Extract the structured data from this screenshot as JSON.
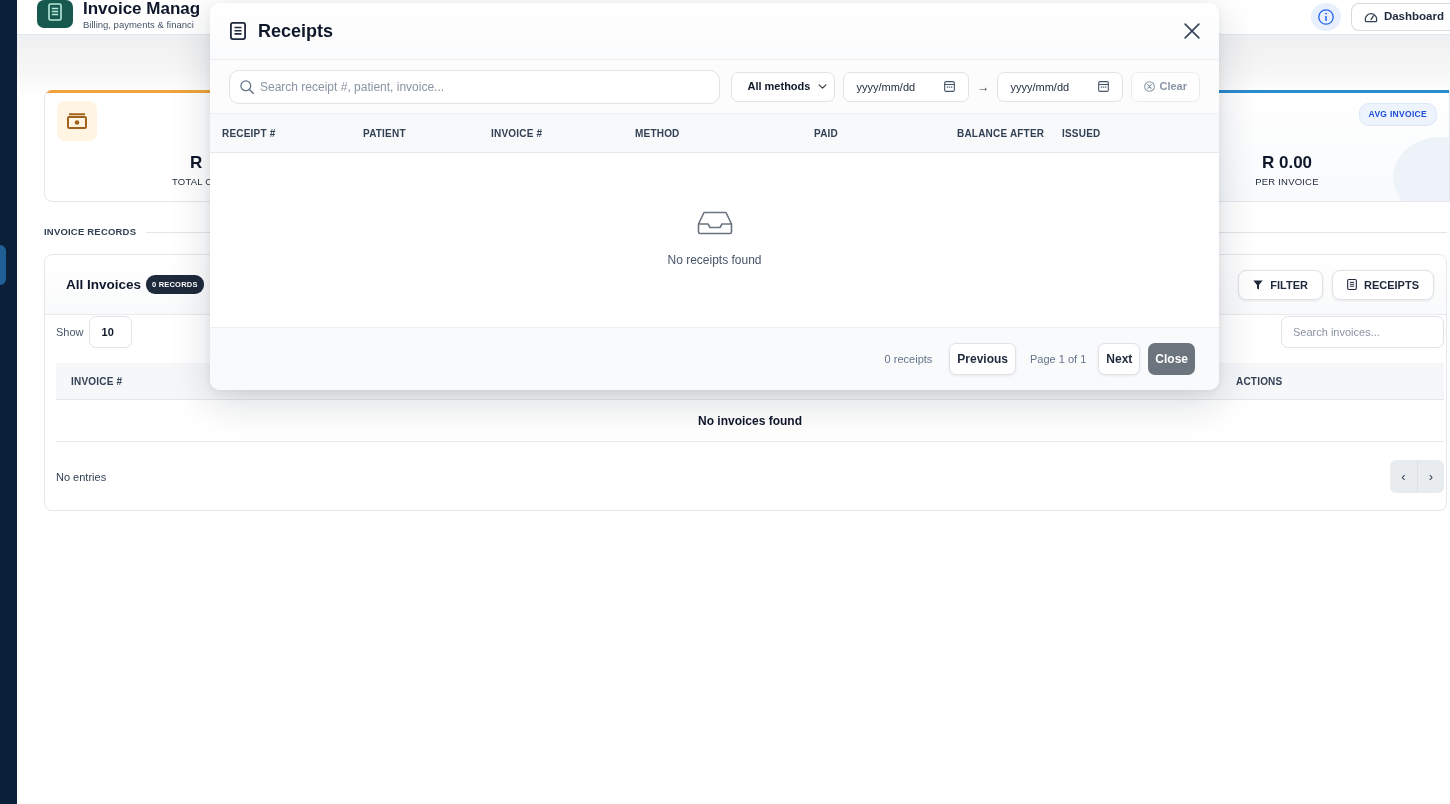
{
  "sidebar": {
    "items": [
      {
        "selected": true
      }
    ]
  },
  "header": {
    "title": "Invoice Manag",
    "subtitle": "Billing, payments & financi",
    "dashboard_button": {
      "label": "Dashboard"
    }
  },
  "stats": [
    {
      "kind": "icon",
      "value": "R",
      "label": "TOTAL C",
      "color": "#f0a33a"
    },
    {
      "kind": "badge",
      "badge": "AVG INVOICE",
      "value": "R 0.00",
      "label": "PER INVOICE",
      "color": "#2a8ccf"
    }
  ],
  "section_label": "INVOICE RECORDS",
  "invoices": {
    "title": "All Invoices",
    "count_badge": "0 RECORDS",
    "buttons": [
      {
        "kind": "filter",
        "label": "FILTER"
      },
      {
        "kind": "receipts",
        "label": "RECEIPTS"
      }
    ],
    "show_label": "Show",
    "page_size": "10",
    "search": {
      "placeholder": "Search invoices..."
    },
    "columns": [
      "INVOICE #",
      "ACTIONS"
    ],
    "empty_text": "No invoices found",
    "entries_text": "No entries",
    "pager": [
      "‹",
      "›"
    ]
  },
  "receipts_modal": {
    "title": "Receipts",
    "search": {
      "placeholder": "Search receipt #, patient, invoice..."
    },
    "method_select": {
      "value": "All methods"
    },
    "date_from": {
      "placeholder": "yyyy/mm/dd"
    },
    "range_separator": "→",
    "date_to": {
      "placeholder": "yyyy/mm/dd"
    },
    "clear_button": {
      "label": "Clear",
      "disabled": true
    },
    "columns": [
      "RECEIPT #",
      "PATIENT",
      "INVOICE #",
      "METHOD",
      "PAID",
      "BALANCE AFTER",
      "ISSUED"
    ],
    "empty_text": "No receipts found",
    "footer": {
      "count": "0 receipts",
      "previous": "Previous",
      "page_info": "Page 1 of 1",
      "next": "Next",
      "close": "Close"
    }
  }
}
